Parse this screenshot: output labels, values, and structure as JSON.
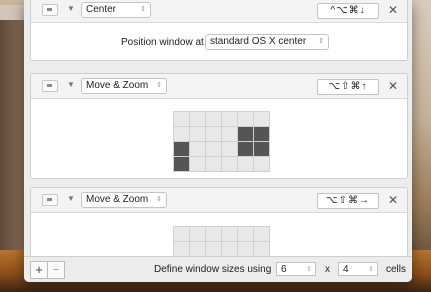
{
  "sections": [
    {
      "action": "Center",
      "shortcut": "^⌥⌘↓",
      "position_label": "Position window at",
      "position_value": "standard OS X center"
    },
    {
      "action": "Move & Zoom",
      "shortcut": "⌥⇧⌘↑",
      "grid_cols": 6,
      "grid_rows": 4,
      "selected_cells": [
        10,
        11,
        12,
        16,
        17,
        18
      ]
    },
    {
      "action": "Move & Zoom",
      "shortcut": "⌥⇧⌘→"
    }
  ],
  "footer": {
    "add_label": "+",
    "remove_label": "−",
    "define_label": "Define window sizes using",
    "cols_value": "6",
    "times_label": "x",
    "rows_value": "4",
    "cells_label": "cells"
  },
  "icons": {
    "disclosure": "disclosure-triangle-icon",
    "close": "close-icon",
    "handle": "drag-handle-icon"
  }
}
